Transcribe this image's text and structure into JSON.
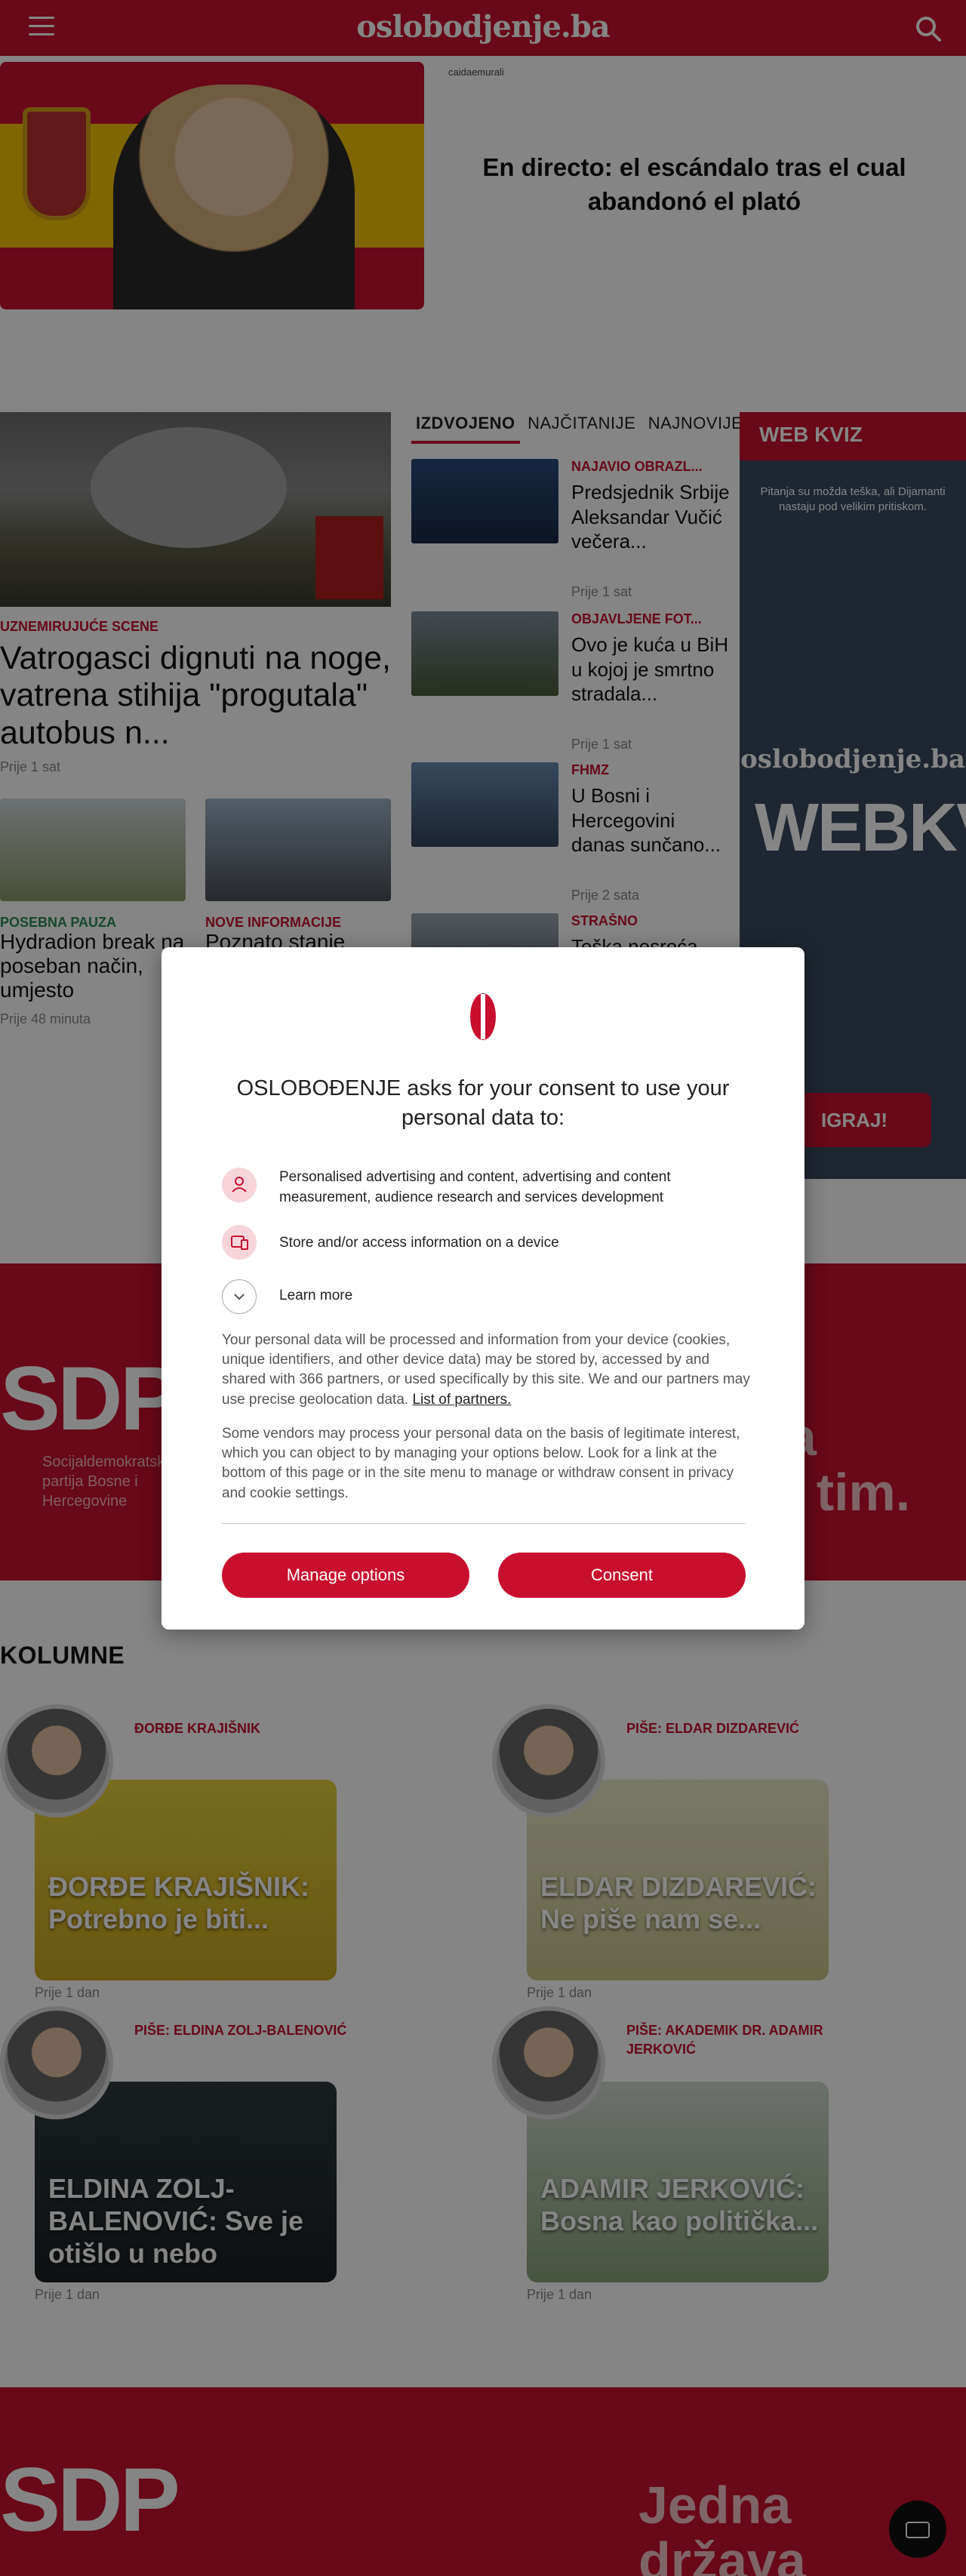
{
  "header": {
    "logo": "oslobodjenje.ba"
  },
  "ad": {
    "source": "caidaemurali",
    "title": "En directo: el escándalo tras el cual abandonó el plató"
  },
  "main_story": {
    "kicker": "UZNEMIRUJUĆE SCENE",
    "title": "Vatrogasci dignuti na noge, vatrena stihija \"progutala\" autobus n...",
    "time": "Prije 1 sat"
  },
  "sub_stories": [
    {
      "kicker": "POSEBNA PAUZA",
      "title": "Hydradion break na poseban način, umjesto",
      "time": "Prije 48 minuta"
    },
    {
      "kicker": "NOVE INFORMACIJE",
      "title": "Poznato stanje",
      "time": ""
    }
  ],
  "tabs": [
    "IZDVOJENO",
    "NAJČITANIJE",
    "NAJNOVIJE"
  ],
  "side_items": [
    {
      "kicker": "NAJAVIO OBRAZL...",
      "title": "Predsjednik Srbije Aleksandar Vučić večera...",
      "time": "Prije 1 sat"
    },
    {
      "kicker": "OBJAVLJENE FOT...",
      "title": "Ovo je kuća u BiH u kojoj je smrtno stradala...",
      "time": "Prije 1 sat"
    },
    {
      "kicker": "FHMZ",
      "title": "U Bosni i Hercegovini danas sunčano...",
      "time": "Prije 2 sata"
    },
    {
      "kicker": "STRAŠNO",
      "title": "Teška nesreća",
      "time": ""
    }
  ],
  "web_kviz": {
    "heading": "WEB KVIZ",
    "text": "Pitanja su možda teška, ali Dijamanti nastaju pod velikim pritiskom.",
    "logo": "oslobodjenje.ba",
    "big": "WEBKVI",
    "button": "IGRAJ!"
  },
  "sdp_banner": {
    "logo": "SDP",
    "sub": "Socijaldemokratska partija Bosne i Hercegovine",
    "slogan": "Jedna država Jedan tim."
  },
  "kolumne": {
    "title": "KOLUMNE",
    "items": [
      {
        "author": "ĐORĐE KRAJIŠNIK",
        "title": "ĐORĐE KRAJIŠNIK: Potrebno je biti...",
        "time": "Prije 1 dan"
      },
      {
        "author": "PIŠE: ELDAR DIZDAREVIĆ",
        "title": "ELDAR DIZDAREVIĆ: Ne piše nam se...",
        "time": "Prije 1 dan"
      },
      {
        "author": "PIŠE: ELDINA ZOLJ-BALENOVIĆ",
        "title": "ELDINA ZOLJ-BALENOVIĆ: Sve je otišlo u nebo",
        "time": "Prije 1 dan"
      },
      {
        "author": "PIŠE: AKADEMIK DR. ADAMIR JERKOVIĆ",
        "title": "ADAMIR JERKOVIĆ: Bosna kao politička...",
        "time": "Prije 1 dan"
      }
    ]
  },
  "consent": {
    "title": "OSLOBOĐENJE asks for your consent to use your personal data to:",
    "purposes": [
      "Personalised advertising and content, advertising and content measurement, audience research and services development",
      "Store and/or access information on a device"
    ],
    "learn_more": "Learn more",
    "paragraph1": "Your personal data will be processed and information from your device (cookies, unique identifiers, and other device data) may be stored by, accessed by and shared with 366 partners, or used specifically by this site. We and our partners may use precise geolocation data.",
    "partners_link": "List of partners.",
    "paragraph2": "Some vendors may process your personal data on the basis of legitimate interest, which you can object to by managing your options below. Look for a link at the bottom of this page or in the site menu to manage or withdraw consent in privacy and cookie settings.",
    "manage_button": "Manage options",
    "consent_button": "Consent"
  },
  "colors": {
    "brand": "#c8102e",
    "overlay": "rgba(0,0,0,0.48)"
  }
}
